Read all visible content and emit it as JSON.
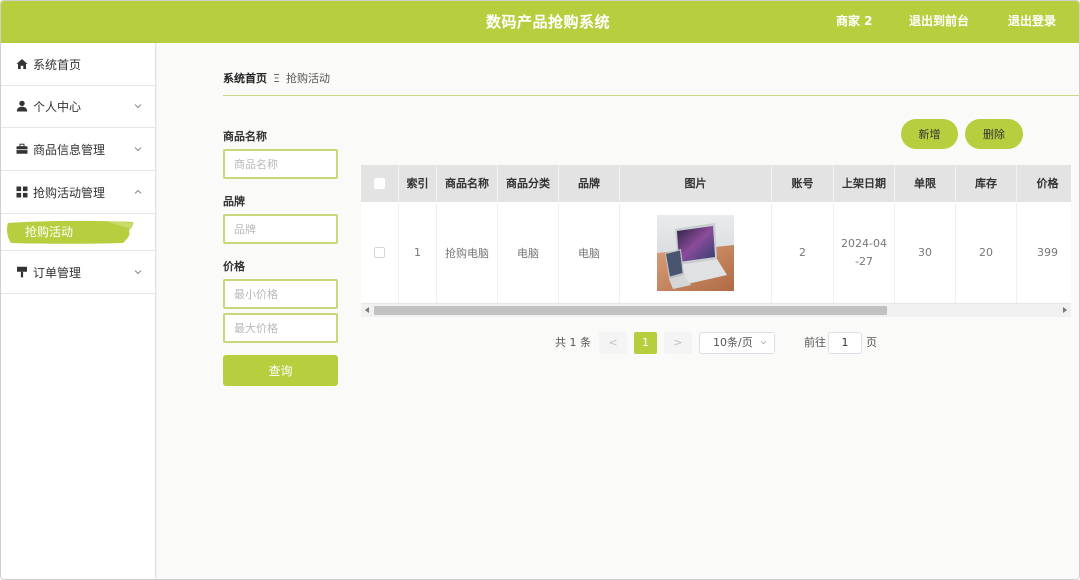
{
  "header": {
    "title": "数码产品抢购系统",
    "user": "商家 2",
    "front_link": "退出到前台",
    "logout": "退出登录",
    "accent": "#b7cf3f"
  },
  "sidebar": {
    "items": [
      {
        "label": "系统首页",
        "icon": "home-icon"
      },
      {
        "label": "个人中心",
        "icon": "user-icon"
      },
      {
        "label": "商品信息管理",
        "icon": "briefcase-icon"
      },
      {
        "label": "抢购活动管理",
        "icon": "grid-icon"
      },
      {
        "label": "订单管理",
        "icon": "hammer-icon"
      }
    ],
    "active_sub": "抢购活动"
  },
  "breadcrumb": {
    "home": "系统首页",
    "separator": "Ξ",
    "current": "抢购活动"
  },
  "search": {
    "name_label": "商品名称",
    "name_placeholder": "商品名称",
    "brand_label": "品牌",
    "brand_placeholder": "品牌",
    "price_label": "价格",
    "min_price_placeholder": "最小价格",
    "max_price_placeholder": "最大价格",
    "query_button": "查询"
  },
  "actions": {
    "add": "新增",
    "delete": "删除"
  },
  "table": {
    "columns": [
      "索引",
      "商品名称",
      "商品分类",
      "品牌",
      "图片",
      "账号",
      "上架日期",
      "单限",
      "库存",
      "价格"
    ],
    "rows": [
      {
        "index": "1",
        "name": "抢购电脑",
        "category": "电脑",
        "brand": "电脑",
        "image": "laptop-photo",
        "account": "2",
        "date": "2024-04-27",
        "limit": "30",
        "stock": "20",
        "price": "399"
      }
    ]
  },
  "pagination": {
    "total": "共 1 条",
    "prev": "<",
    "current_page": "1",
    "next": ">",
    "page_size": "10条/页",
    "goto_label": "前往",
    "goto_value": "1",
    "page_suffix": "页"
  }
}
